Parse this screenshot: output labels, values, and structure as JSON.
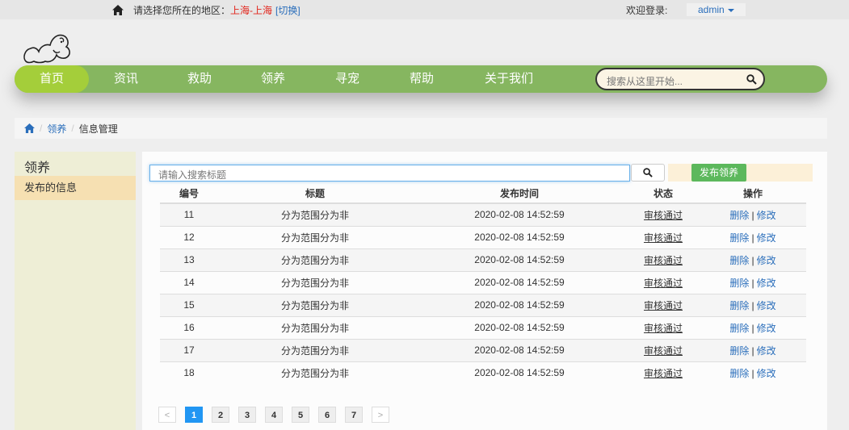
{
  "topbar": {
    "region_prefix": "请选择您所在的地区：",
    "region_city": "上海-上海",
    "switch_label": "[切换]",
    "welcome": "欢迎登录:",
    "user": "admin"
  },
  "nav": {
    "items": [
      "首页",
      "资讯",
      "救助",
      "领养",
      "寻宠",
      "帮助",
      "关于我们"
    ],
    "search_placeholder": "搜索从这里开始..."
  },
  "breadcrumb": {
    "link": "领养",
    "current": "信息管理"
  },
  "sidebar": {
    "title": "领养",
    "item": "发布的信息"
  },
  "main": {
    "search_placeholder": "请输入搜索标题",
    "publish_label": "发布领养",
    "columns": [
      "编号",
      "标题",
      "发布时间",
      "状态",
      "操作"
    ],
    "rows": [
      {
        "id": "11",
        "title": "分为范围分为非",
        "time": "2020-02-08 14:52:59",
        "status": "审核通过"
      },
      {
        "id": "12",
        "title": "分为范围分为非",
        "time": "2020-02-08 14:52:59",
        "status": "审核通过"
      },
      {
        "id": "13",
        "title": "分为范围分为非",
        "time": "2020-02-08 14:52:59",
        "status": "审核通过"
      },
      {
        "id": "14",
        "title": "分为范围分为非",
        "time": "2020-02-08 14:52:59",
        "status": "审核通过"
      },
      {
        "id": "15",
        "title": "分为范围分为非",
        "time": "2020-02-08 14:52:59",
        "status": "审核通过"
      },
      {
        "id": "16",
        "title": "分为范围分为非",
        "time": "2020-02-08 14:52:59",
        "status": "审核通过"
      },
      {
        "id": "17",
        "title": "分为范围分为非",
        "time": "2020-02-08 14:52:59",
        "status": "审核通过"
      },
      {
        "id": "18",
        "title": "分为范围分为非",
        "time": "2020-02-08 14:52:59",
        "status": "审核通过"
      }
    ],
    "op_delete": "删除",
    "op_sep": "|",
    "op_edit": "修改"
  },
  "pager": {
    "prev": "<",
    "pages": [
      "1",
      "2",
      "3",
      "4",
      "5",
      "6",
      "7"
    ],
    "next": ">",
    "current": "1"
  },
  "colors": {
    "nav_green": "#86b660",
    "nav_active": "#a4ce3a",
    "link_blue": "#2a6ebb",
    "city_red": "#e2231a",
    "publish_green": "#5cb85c",
    "pager_active": "#2196f3"
  }
}
